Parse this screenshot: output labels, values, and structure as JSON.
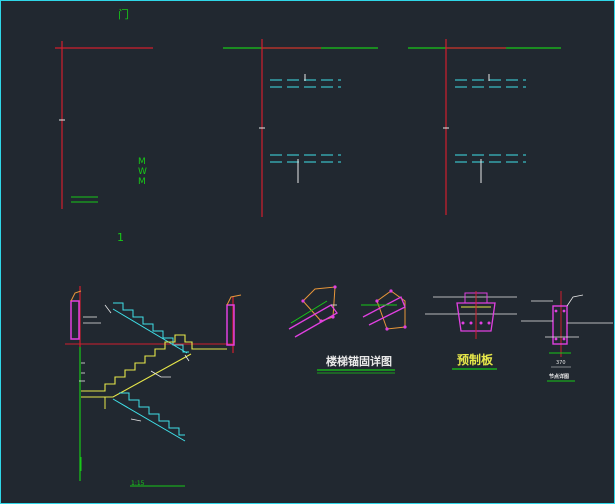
{
  "drawing": {
    "top_mark": "门",
    "mid_mark": "1",
    "vertical_mark_a": "M",
    "vertical_mark_b": "W",
    "scale_label": "1:15",
    "detail_captions": {
      "anchor_detail": "楼梯锚固详图",
      "precast_slab": "预制板",
      "section": "节点详图"
    },
    "dim_text": "370"
  },
  "colors": {
    "background": "#212830",
    "frame": "#2fd7e8",
    "axis_red": "#d01e2e",
    "axis_green": "#18c818",
    "cyan": "#3fe0e8",
    "yellow": "#e8e84a",
    "magenta": "#e040e0",
    "orange": "#e8963a",
    "white": "#e8e8e8"
  }
}
